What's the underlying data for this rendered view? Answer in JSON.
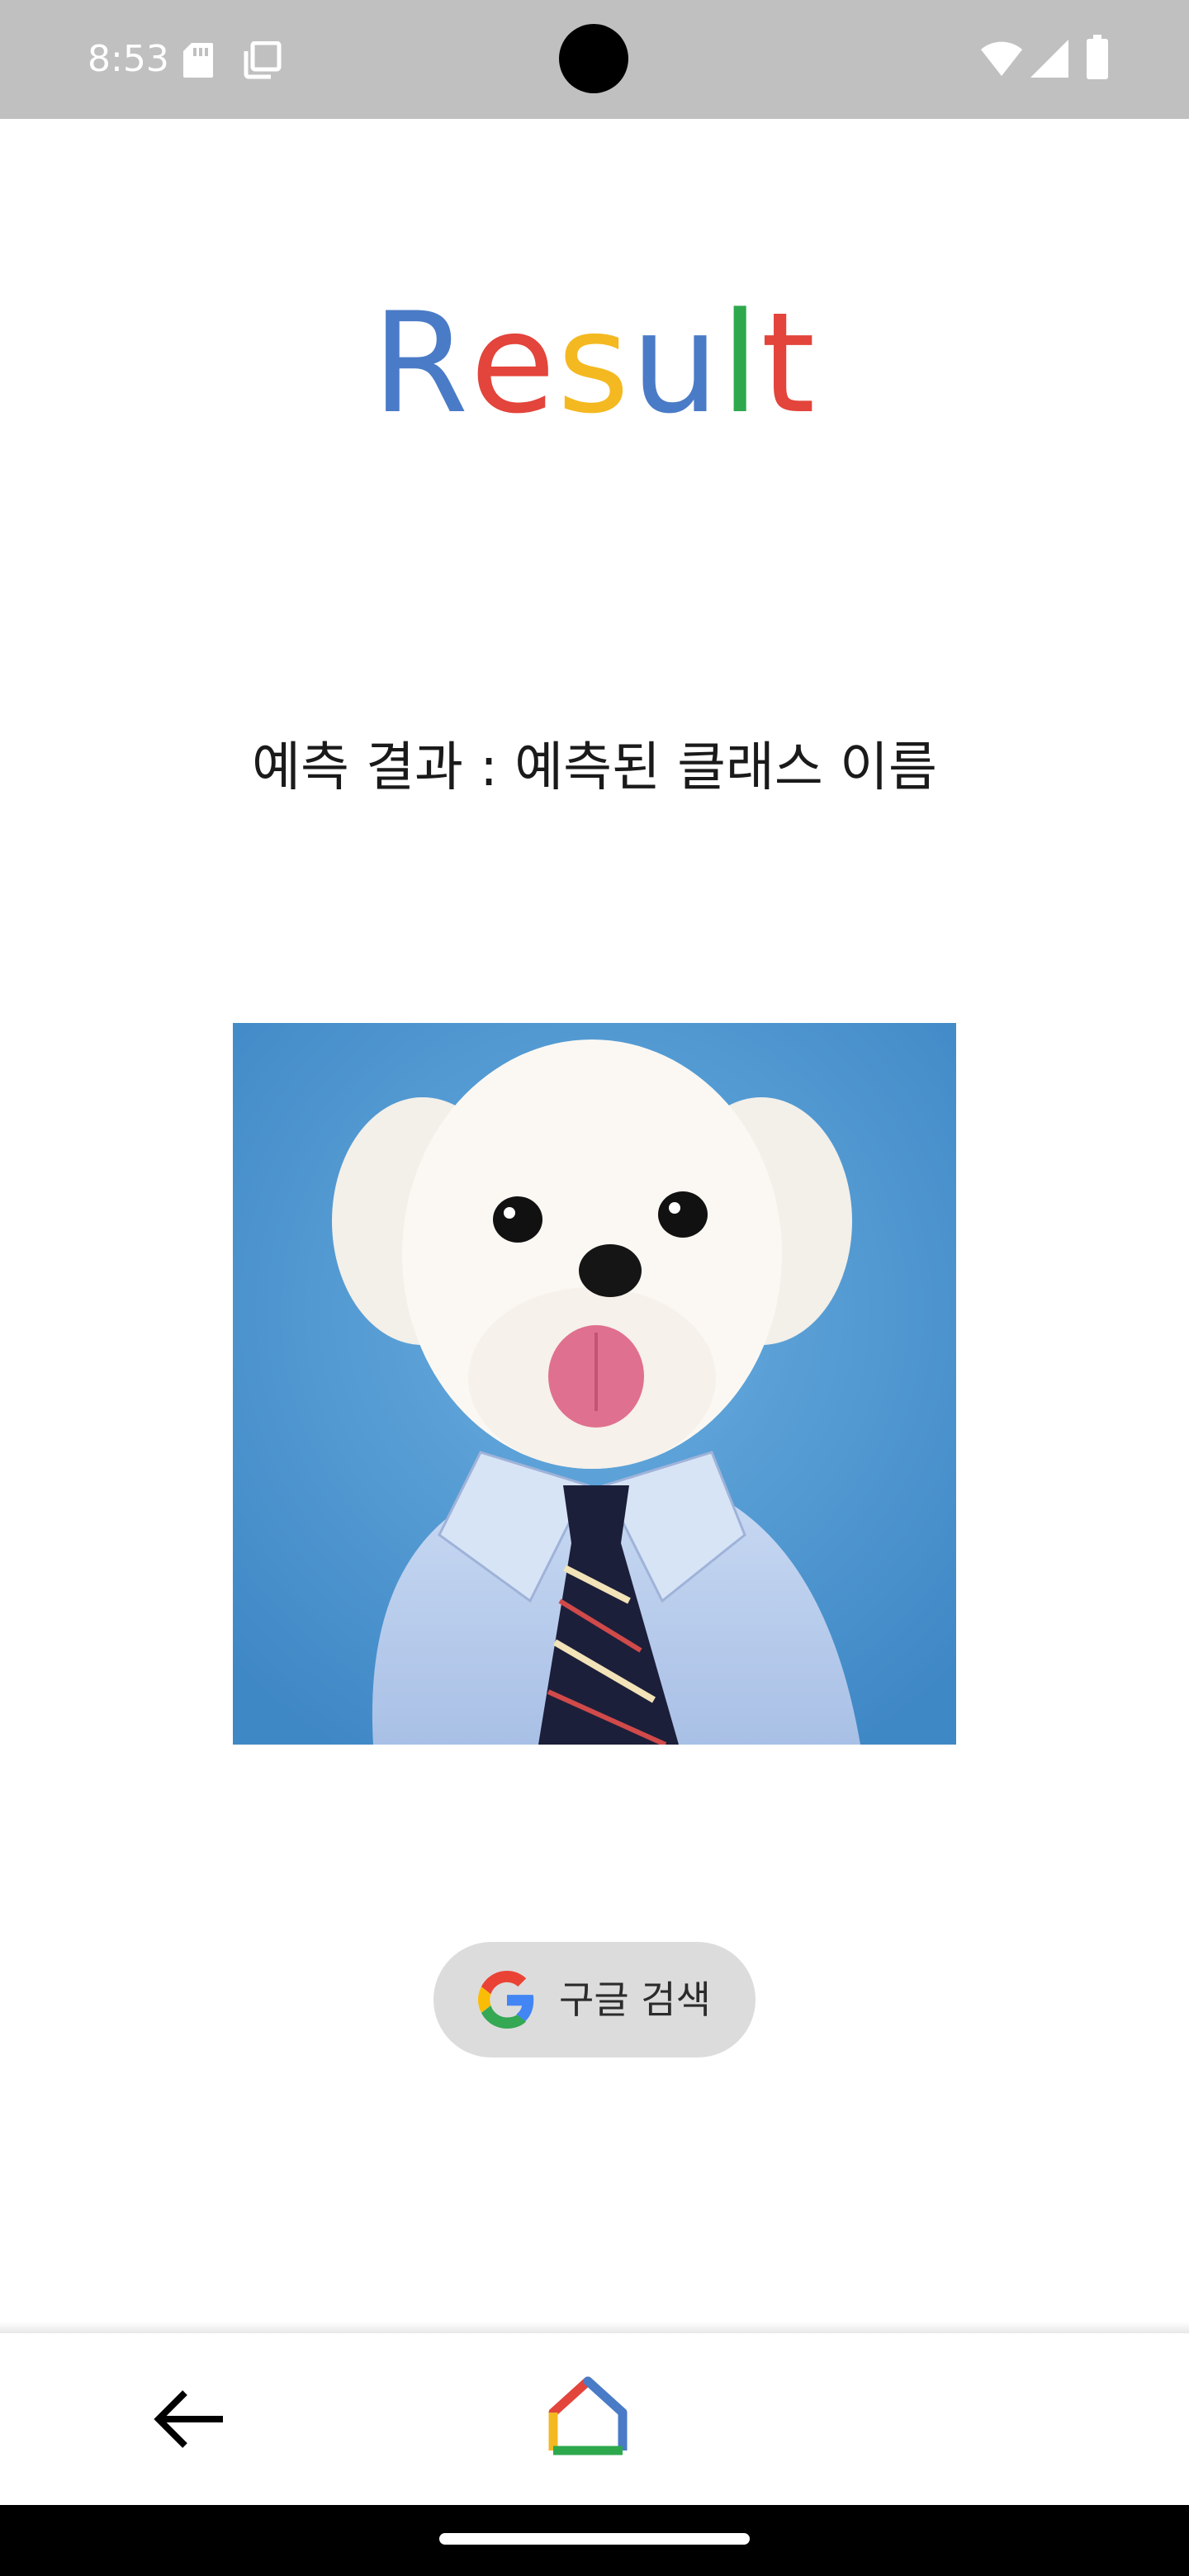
{
  "status_bar": {
    "time": "8:53",
    "icons_left": [
      "sd-card-icon",
      "copy-icon"
    ],
    "icons_right": [
      "wifi-icon",
      "cellular-signal-icon",
      "battery-icon"
    ]
  },
  "title": {
    "letters": [
      "R",
      "e",
      "s",
      "u",
      "l",
      "t"
    ],
    "colors": [
      "#4a7bc7",
      "#e3443b",
      "#f4b921",
      "#4a7bc7",
      "#2ea84d",
      "#e3443b"
    ]
  },
  "prediction": {
    "text": "예측 결과 : 예측된 클래스 이름"
  },
  "photo": {
    "subject": "dog-photo"
  },
  "search_button": {
    "label": "구글 검색",
    "icon": "google-g-icon"
  },
  "bottom_nav": {
    "back_icon": "back-arrow-icon",
    "home_icon": "home-icon"
  },
  "colors": {
    "status_bar_bg": "#c0c0c0",
    "button_bg": "#dcdcdc",
    "photo_bg": "#4f98d2"
  }
}
